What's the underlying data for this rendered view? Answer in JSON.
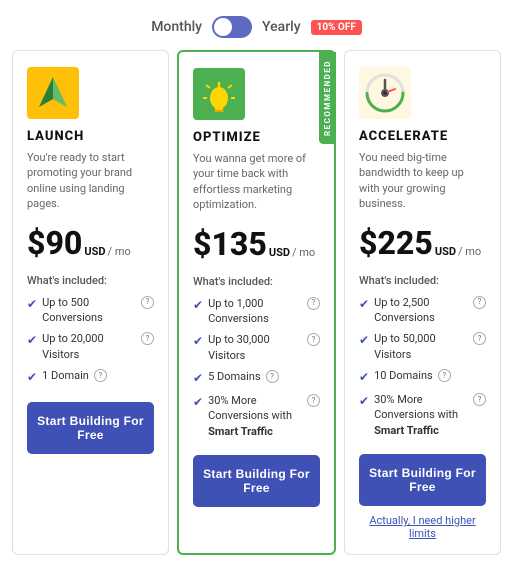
{
  "billing": {
    "monthly_label": "Monthly",
    "yearly_label": "Yearly",
    "discount_label": "10% OFF"
  },
  "plans": [
    {
      "id": "launch",
      "name": "LAUNCH",
      "description": "You're ready to start promoting your brand online using landing pages.",
      "price": "$90",
      "currency": "USD",
      "period": "/ mo",
      "whats_included": "What's included:",
      "features": [
        {
          "text": "Up to 500 Conversions",
          "info": true
        },
        {
          "text": "Up to 20,000 Visitors",
          "info": true
        },
        {
          "text": "1 Domain",
          "info": true
        }
      ],
      "cta": "Start Building For Free",
      "recommended": false
    },
    {
      "id": "optimize",
      "name": "OPTIMIZE",
      "description": "You wanna get more of your time back with effortless marketing optimization.",
      "price": "$135",
      "currency": "USD",
      "period": "/ mo",
      "whats_included": "What's included:",
      "features": [
        {
          "text": "Up to 1,000 Conversions",
          "info": true
        },
        {
          "text": "Up to 30,000 Visitors",
          "info": true
        },
        {
          "text": "5 Domains",
          "info": true
        },
        {
          "text": "30% More Conversions with ",
          "bold_suffix": "Smart Traffic",
          "info": true
        }
      ],
      "cta": "Start Building For Free",
      "recommended": true,
      "recommended_label": "RECOMMENDED"
    },
    {
      "id": "accelerate",
      "name": "ACCELERATE",
      "description": "You need big-time bandwidth to keep up with your growing business.",
      "price": "$225",
      "currency": "USD",
      "period": "/ mo",
      "whats_included": "What's included:",
      "features": [
        {
          "text": "Up to 2,500 Conversions",
          "info": true
        },
        {
          "text": "Up to 50,000 Visitors",
          "info": true
        },
        {
          "text": "10 Domains",
          "info": true
        },
        {
          "text": "30% More Conversions with ",
          "bold_suffix": "Smart Traffic",
          "info": true
        }
      ],
      "cta": "Start Building For Free",
      "recommended": false,
      "higher_limits_label": "Actually, I need higher limits"
    }
  ]
}
